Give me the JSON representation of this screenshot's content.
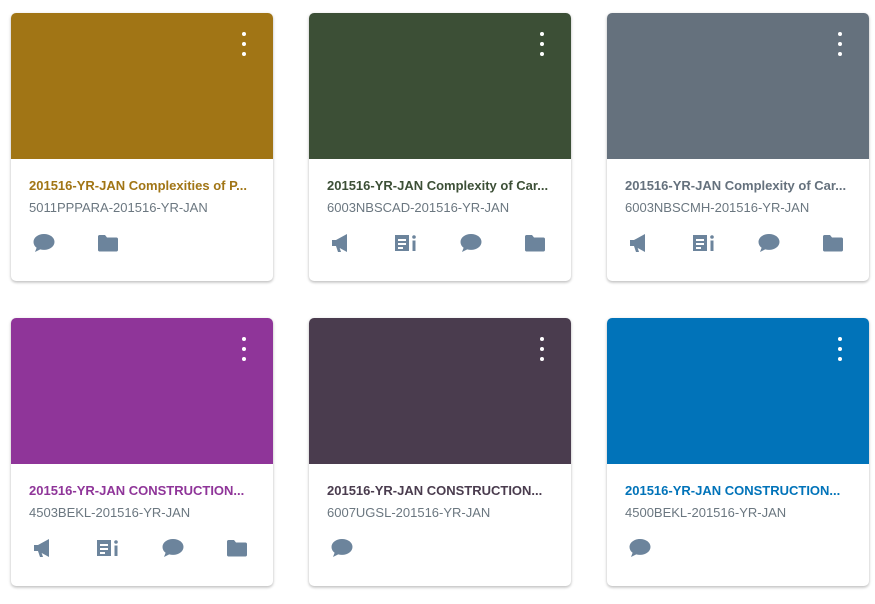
{
  "cards": [
    {
      "title": "201516-YR-JAN Complexities of P...",
      "code": "5011PPPARA-201516-YR-JAN",
      "color": "#a17515",
      "title_color": "#a17515",
      "actions": [
        "discussions-icon",
        "files-icon"
      ]
    },
    {
      "title": "201516-YR-JAN Complexity of Car...",
      "code": "6003NBSCAD-201516-YR-JAN",
      "color": "#3c4f36",
      "title_color": "#3c4f36",
      "actions": [
        "announcements-icon",
        "assignments-icon",
        "discussions-icon",
        "files-icon"
      ]
    },
    {
      "title": "201516-YR-JAN Complexity of Car...",
      "code": "6003NBSCMH-201516-YR-JAN",
      "color": "#65717d",
      "title_color": "#65717d",
      "actions": [
        "announcements-icon",
        "assignments-icon",
        "discussions-icon",
        "files-icon"
      ]
    },
    {
      "title": "201516-YR-JAN CONSTRUCTION...",
      "code": "4503BEKL-201516-YR-JAN",
      "color": "#8f3599",
      "title_color": "#8f3599",
      "actions": [
        "announcements-icon",
        "assignments-icon",
        "discussions-icon",
        "files-icon"
      ]
    },
    {
      "title": "201516-YR-JAN CONSTRUCTION...",
      "code": "6007UGSL-201516-YR-JAN",
      "color": "#4a3c4e",
      "title_color": "#4a3c4e",
      "actions": [
        "discussions-icon"
      ]
    },
    {
      "title": "201516-YR-JAN CONSTRUCTION...",
      "code": "4500BEKL-201516-YR-JAN",
      "color": "#0173b9",
      "title_color": "#0173b9",
      "actions": [
        "discussions-icon"
      ]
    }
  ],
  "icon_color": "#6c849c"
}
